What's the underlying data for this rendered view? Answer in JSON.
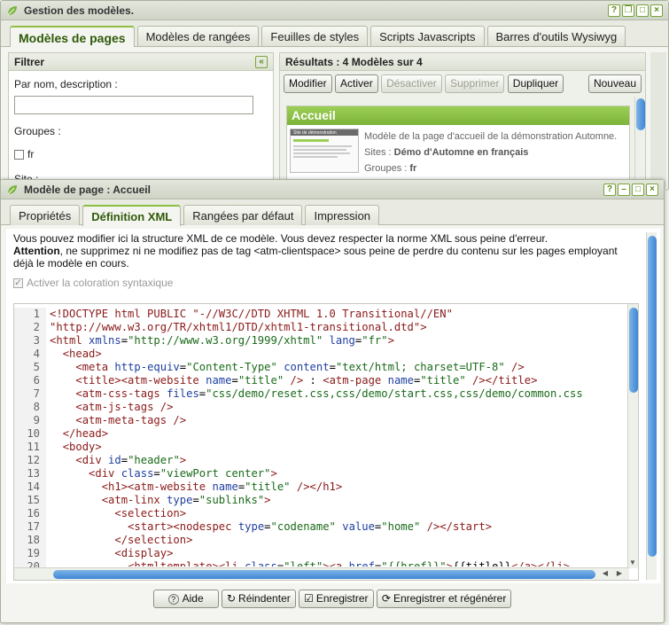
{
  "back_window": {
    "title": "Gestion des modèles.",
    "tabs": [
      "Modèles de pages",
      "Modèles de rangées",
      "Feuilles de styles",
      "Scripts Javascripts",
      "Barres d'outils Wysiwyg"
    ],
    "filter": {
      "title": "Filtrer",
      "name_label": "Par nom, description :",
      "name_value": "",
      "groups_label": "Groupes :",
      "group_fr": "fr",
      "site_label": "Site :"
    },
    "results": {
      "title": "Résultats : 4 Modèles sur 4",
      "buttons": {
        "modify": "Modifier",
        "activate": "Activer",
        "deactivate": "Désactiver",
        "delete": "Supprimer",
        "duplicate": "Dupliquer",
        "new": "Nouveau"
      },
      "item": {
        "name": "Accueil",
        "description": "Modèle de la page d'accueil de la démonstration Automne.",
        "sites_label": "Sites :",
        "sites_value": "Démo d'Automne en français",
        "groups_label": "Groupes :",
        "groups_value": "fr",
        "thumb_caption": "Site de démonstration"
      }
    }
  },
  "front_window": {
    "title": "Modèle de page : Accueil",
    "tabs": [
      "Propriétés",
      "Définition XML",
      "Rangées par défaut",
      "Impression"
    ],
    "info_line1": "Vous pouvez modifier ici la structure XML de ce modèle. Vous devez respecter la norme XML sous peine d'erreur.",
    "info_bold": "Attention",
    "info_line2": ", ne supprimez ni ne modifiez pas de tag <atm-clientspace> sous peine de perdre du contenu sur les pages employant déjà le modèle en cours.",
    "syntax_checkbox_label": "Activer la coloration syntaxique",
    "syntax_checked": true,
    "code_lines": [
      [
        [
          "tag",
          "<!DOCTYPE html PUBLIC \"-//W3C//DTD XHTML 1.0 Transitional//EN\""
        ]
      ],
      [
        [
          "tag",
          "\"http://www.w3.org/TR/xhtml1/DTD/xhtml1-transitional.dtd\">"
        ]
      ],
      [
        [
          "tag",
          "<html "
        ],
        [
          "attr",
          "xmlns"
        ],
        [
          "plain",
          "="
        ],
        [
          "str",
          "\"http://www.w3.org/1999/xhtml\""
        ],
        [
          "plain",
          " "
        ],
        [
          "attr",
          "lang"
        ],
        [
          "plain",
          "="
        ],
        [
          "str",
          "\"fr\""
        ],
        [
          "tag",
          ">"
        ]
      ],
      [
        [
          "plain",
          "  "
        ],
        [
          "tag",
          "<head>"
        ]
      ],
      [
        [
          "plain",
          "    "
        ],
        [
          "tag",
          "<meta "
        ],
        [
          "attr",
          "http-equiv"
        ],
        [
          "plain",
          "="
        ],
        [
          "str",
          "\"Content-Type\""
        ],
        [
          "plain",
          " "
        ],
        [
          "attr",
          "content"
        ],
        [
          "plain",
          "="
        ],
        [
          "str",
          "\"text/html; charset=UTF-8\""
        ],
        [
          "plain",
          " "
        ],
        [
          "tag",
          "/>"
        ]
      ],
      [
        [
          "plain",
          "    "
        ],
        [
          "tag",
          "<title><atm-website "
        ],
        [
          "attr",
          "name"
        ],
        [
          "plain",
          "="
        ],
        [
          "str",
          "\"title\""
        ],
        [
          "plain",
          " "
        ],
        [
          "tag",
          "/>"
        ],
        [
          "plain",
          " : "
        ],
        [
          "tag",
          "<atm-page "
        ],
        [
          "attr",
          "name"
        ],
        [
          "plain",
          "="
        ],
        [
          "str",
          "\"title\""
        ],
        [
          "plain",
          " "
        ],
        [
          "tag",
          "/></title>"
        ]
      ],
      [
        [
          "plain",
          "    "
        ],
        [
          "tag",
          "<atm-css-tags "
        ],
        [
          "attr",
          "files"
        ],
        [
          "plain",
          "="
        ],
        [
          "str",
          "\"css/demo/reset.css,css/demo/start.css,css/demo/common.css"
        ]
      ],
      [
        [
          "plain",
          "    "
        ],
        [
          "tag",
          "<atm-js-tags />"
        ]
      ],
      [
        [
          "plain",
          "    "
        ],
        [
          "tag",
          "<atm-meta-tags />"
        ]
      ],
      [
        [
          "plain",
          "  "
        ],
        [
          "tag",
          "</head>"
        ]
      ],
      [
        [
          "plain",
          "  "
        ],
        [
          "tag",
          "<body>"
        ]
      ],
      [
        [
          "plain",
          "    "
        ],
        [
          "tag",
          "<div "
        ],
        [
          "attr",
          "id"
        ],
        [
          "plain",
          "="
        ],
        [
          "str",
          "\"header\""
        ],
        [
          "tag",
          ">"
        ]
      ],
      [
        [
          "plain",
          "      "
        ],
        [
          "tag",
          "<div "
        ],
        [
          "attr",
          "class"
        ],
        [
          "plain",
          "="
        ],
        [
          "str",
          "\"viewPort center\""
        ],
        [
          "tag",
          ">"
        ]
      ],
      [
        [
          "plain",
          "        "
        ],
        [
          "tag",
          "<h1><atm-website "
        ],
        [
          "attr",
          "name"
        ],
        [
          "plain",
          "="
        ],
        [
          "str",
          "\"title\""
        ],
        [
          "plain",
          " "
        ],
        [
          "tag",
          "/></h1>"
        ]
      ],
      [
        [
          "plain",
          "        "
        ],
        [
          "tag",
          "<atm-linx "
        ],
        [
          "attr",
          "type"
        ],
        [
          "plain",
          "="
        ],
        [
          "str",
          "\"sublinks\""
        ],
        [
          "tag",
          ">"
        ]
      ],
      [
        [
          "plain",
          "          "
        ],
        [
          "tag",
          "<selection>"
        ]
      ],
      [
        [
          "plain",
          "            "
        ],
        [
          "tag",
          "<start><nodespec "
        ],
        [
          "attr",
          "type"
        ],
        [
          "plain",
          "="
        ],
        [
          "str",
          "\"codename\""
        ],
        [
          "plain",
          " "
        ],
        [
          "attr",
          "value"
        ],
        [
          "plain",
          "="
        ],
        [
          "str",
          "\"home\""
        ],
        [
          "plain",
          " "
        ],
        [
          "tag",
          "/></start>"
        ]
      ],
      [
        [
          "plain",
          "          "
        ],
        [
          "tag",
          "</selection>"
        ]
      ],
      [
        [
          "plain",
          "          "
        ],
        [
          "tag",
          "<display>"
        ]
      ],
      [
        [
          "plain",
          "            "
        ],
        [
          "tag",
          "<htmltemplate><li "
        ],
        [
          "attr",
          "class"
        ],
        [
          "plain",
          "="
        ],
        [
          "str",
          "\"left\""
        ],
        [
          "tag",
          "><a "
        ],
        [
          "attr",
          "href"
        ],
        [
          "plain",
          "="
        ],
        [
          "str",
          "\"{{href}}\""
        ],
        [
          "tag",
          ">"
        ],
        [
          "plain",
          "{{title}}"
        ],
        [
          "tag",
          "</a></li>"
        ]
      ],
      [
        [
          "plain",
          ""
        ]
      ]
    ],
    "footer_buttons": {
      "help": "Aide",
      "reindent": "Réindenter",
      "save": "Enregistrer",
      "save_regen": "Enregistrer et régénérer"
    }
  }
}
